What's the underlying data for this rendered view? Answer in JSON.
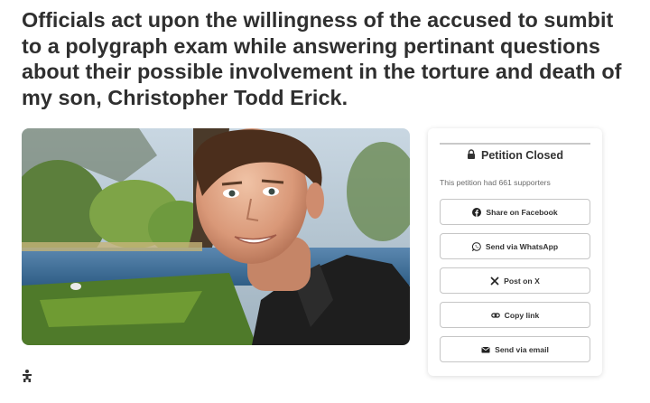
{
  "headline": "Officials act upon the willingness of the accused to sumbit to a polygraph exam while answering pertinant questions about their possible involvement in the torture and death of my son, Christopher Todd Erick.",
  "status_card": {
    "title": "Petition Closed",
    "supporters_text": "This petition had 661 supporters",
    "buttons": [
      {
        "label": "Share on Facebook",
        "icon": "facebook-icon"
      },
      {
        "label": "Send via WhatsApp",
        "icon": "whatsapp-icon"
      },
      {
        "label": "Post on X",
        "icon": "x-icon"
      },
      {
        "label": "Copy link",
        "icon": "link-icon"
      },
      {
        "label": "Send via email",
        "icon": "email-icon"
      }
    ]
  },
  "colors": {
    "headline": "#2f2f2f",
    "button_border": "#c6c6c6",
    "muted_text": "#6b6b6b"
  }
}
